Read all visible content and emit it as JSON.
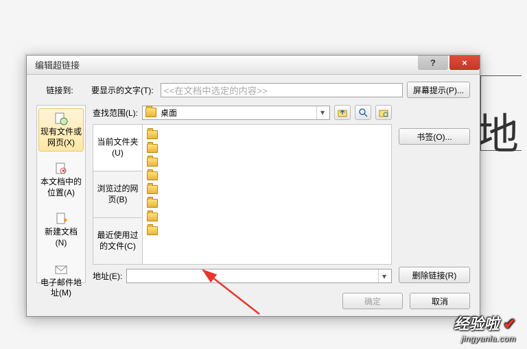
{
  "backdrop_char": "地",
  "dialog": {
    "title": "编辑超链接",
    "help_glyph": "?",
    "close_glyph": "×"
  },
  "labels": {
    "link_to": "链接到:",
    "display_text": "要显示的文字(T):",
    "display_placeholder": "<<在文档中选定的内容>>",
    "lookup": "查找范围(L):",
    "address": "地址(E):"
  },
  "buttons": {
    "screentip": "屏幕提示(P)...",
    "bookmark": "书签(O)...",
    "remove_link": "删除链接(R)",
    "ok": "确定",
    "cancel": "取消"
  },
  "linkto_items": [
    {
      "label": "现有文件或网页(X)"
    },
    {
      "label": "本文档中的位置(A)"
    },
    {
      "label": "新建文档(N)"
    },
    {
      "label": "电子邮件地址(M)"
    }
  ],
  "lookup_value": "桌面",
  "browse_tabs": [
    {
      "label": "当前文件夹(U)"
    },
    {
      "label": "浏览过的网页(B)"
    },
    {
      "label": "最近使用过的文件(C)"
    }
  ],
  "file_items": [
    {
      "name": " "
    },
    {
      "name": " "
    },
    {
      "name": " "
    },
    {
      "name": " "
    },
    {
      "name": " "
    },
    {
      "name": " "
    },
    {
      "name": " "
    },
    {
      "name": " "
    }
  ],
  "address_value": "",
  "watermark": {
    "line1": "经验啦",
    "check": "✔",
    "line2": "jingyanla.com"
  }
}
